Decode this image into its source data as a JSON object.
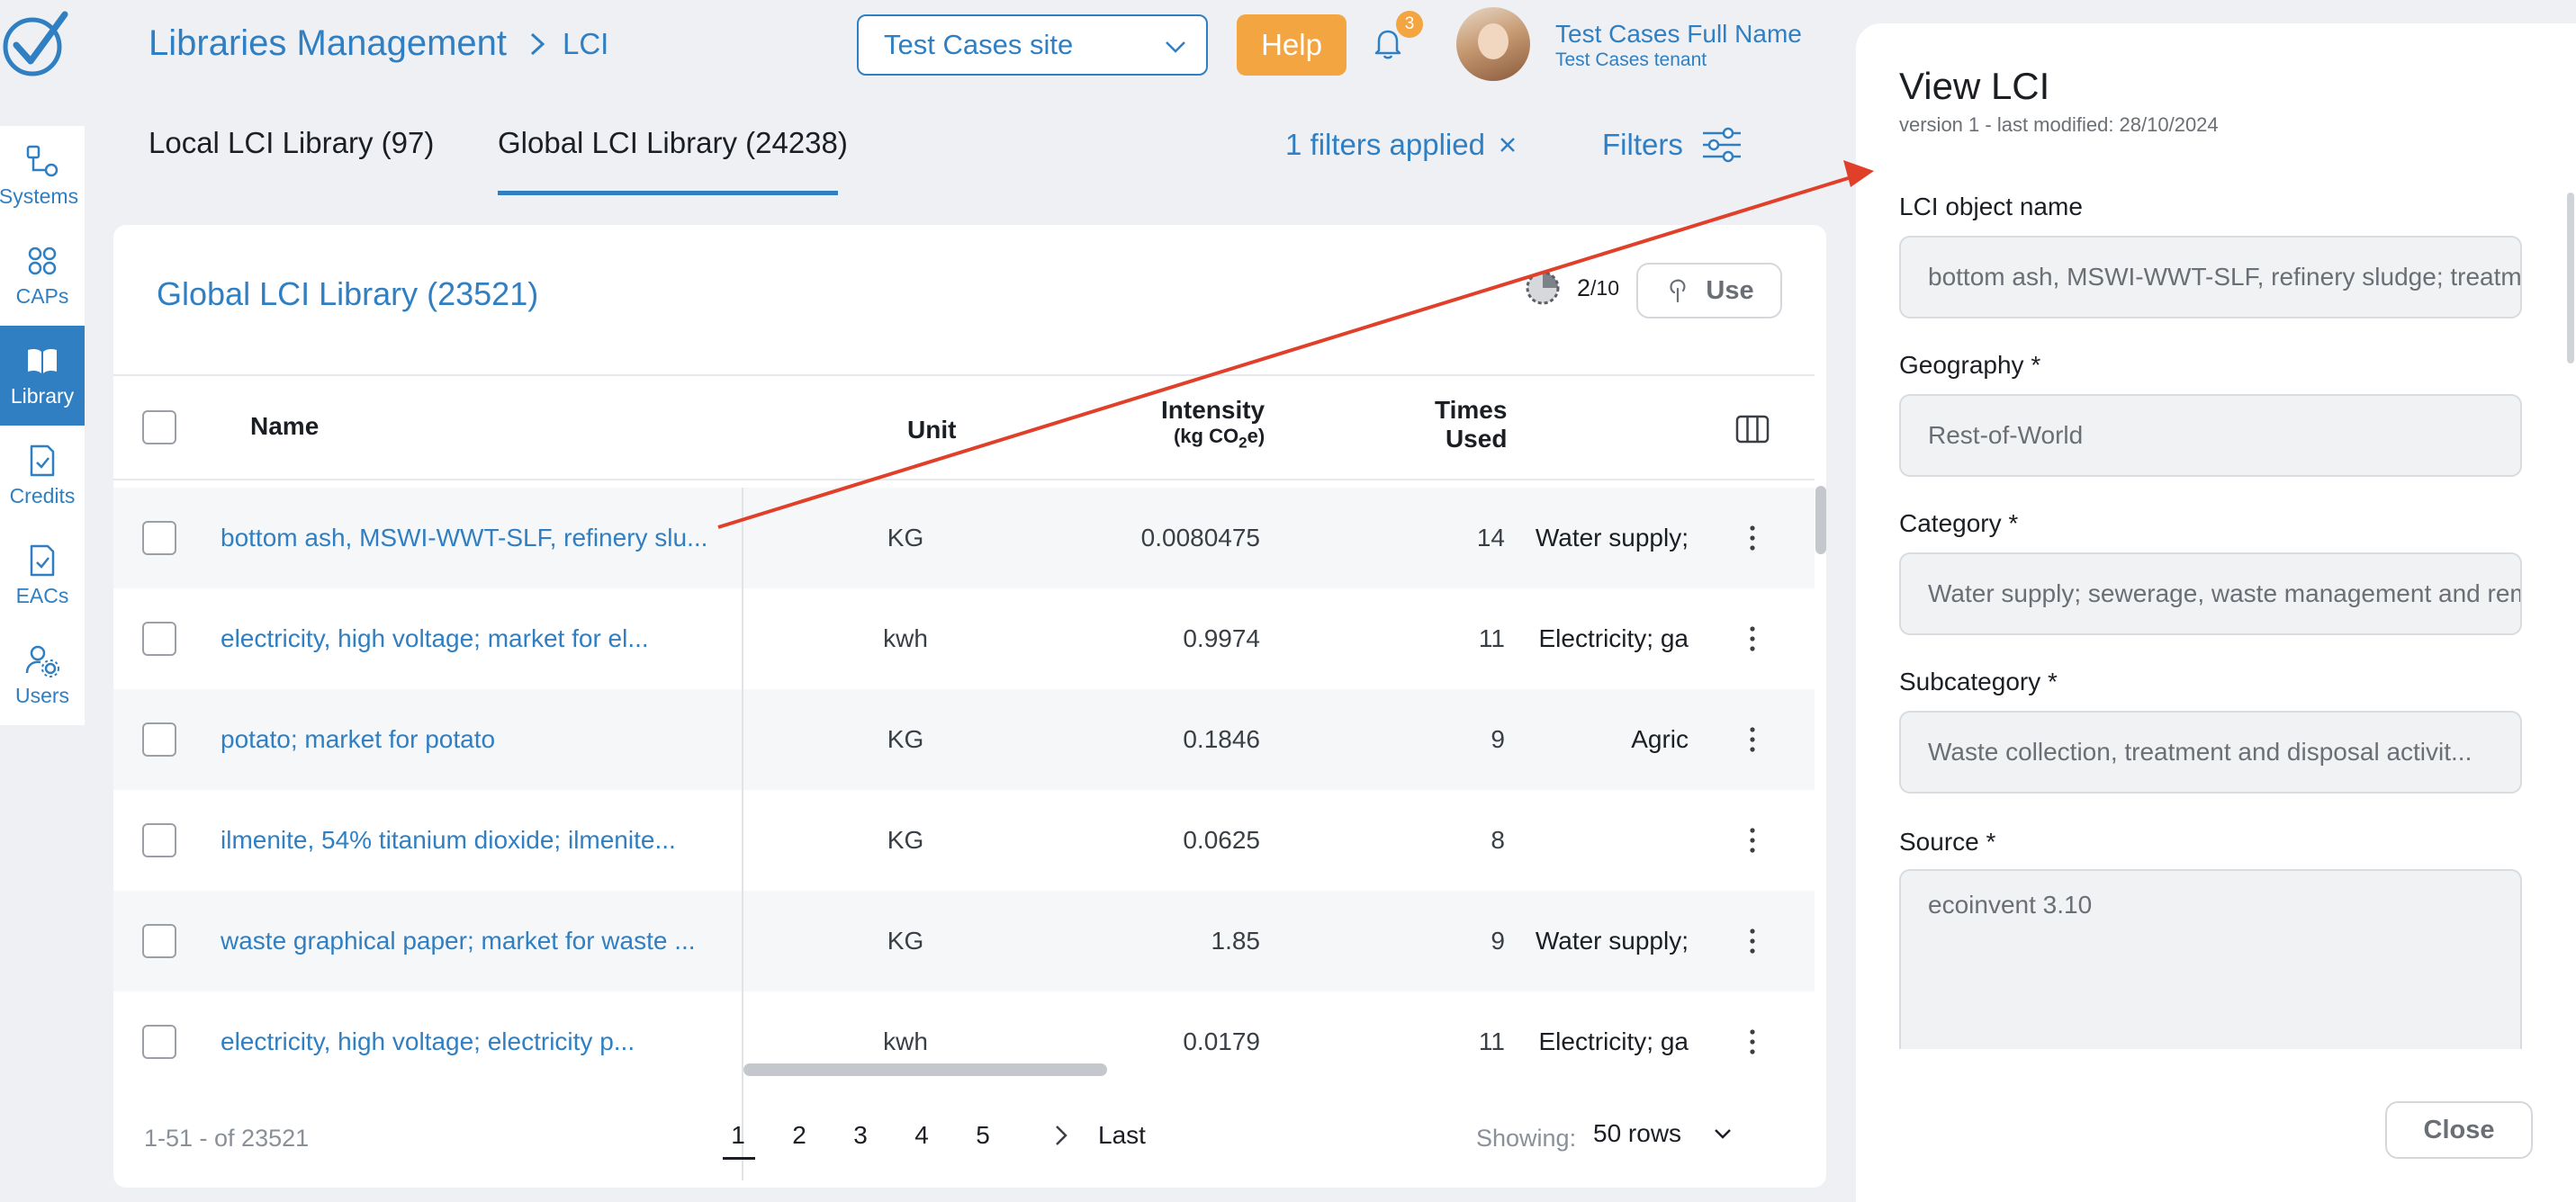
{
  "app": {
    "logo_icon": "check-logo-icon"
  },
  "sidebar": {
    "items": [
      {
        "label": "Systems",
        "icon": "systems-icon"
      },
      {
        "label": "CAPs",
        "icon": "grid-icon"
      },
      {
        "label": "Library",
        "icon": "book-icon",
        "active": true
      },
      {
        "label": "Credits",
        "icon": "credit-doc-icon"
      },
      {
        "label": "EACs",
        "icon": "eac-doc-icon"
      },
      {
        "label": "Users",
        "icon": "users-gear-icon"
      }
    ]
  },
  "header": {
    "breadcrumb_root": "Libraries Management",
    "breadcrumb_current": "LCI",
    "site_select": "Test Cases site",
    "help_label": "Help",
    "notification_count": "3",
    "user_name": "Test Cases Full Name",
    "user_tenant": "Test Cases tenant"
  },
  "tabs": {
    "local": "Local LCI Library (97)",
    "global": "Global LCI Library (24238)",
    "filters_applied": "1 filters applied",
    "filters_label": "Filters"
  },
  "table": {
    "title": "Global LCI Library (23521)",
    "usage_count": "2",
    "usage_total": "/10",
    "use_label": "Use",
    "columns": {
      "name": "Name",
      "unit": "Unit",
      "intensity": "Intensity",
      "intensity_unit_pre": "(kg CO",
      "intensity_unit_sub": "2",
      "intensity_unit_post": "e)",
      "times_line1": "Times",
      "times_line2": "Used"
    },
    "rows": [
      {
        "name": "bottom ash, MSWI-WWT-SLF, refinery slu...",
        "unit": "KG",
        "intensity": "0.0080475",
        "times": "14",
        "category": "Water supply;"
      },
      {
        "name": "electricity, high voltage; market for el...",
        "unit": "kwh",
        "intensity": "0.9974",
        "times": "11",
        "category": "Electricity; ga"
      },
      {
        "name": "potato; market for potato",
        "unit": "KG",
        "intensity": "0.1846",
        "times": "9",
        "category": "Agric"
      },
      {
        "name": "ilmenite, 54% titanium dioxide; ilmenite...",
        "unit": "KG",
        "intensity": "0.0625",
        "times": "8",
        "category": ""
      },
      {
        "name": "waste graphical paper; market for waste ...",
        "unit": "KG",
        "intensity": "1.85",
        "times": "9",
        "category": "Water supply;"
      },
      {
        "name": "electricity, high voltage; electricity p...",
        "unit": "kwh",
        "intensity": "0.0179",
        "times": "11",
        "category": "Electricity; ga"
      }
    ],
    "footer": {
      "range": "1-51 - of 23521",
      "pages": [
        "1",
        "2",
        "3",
        "4",
        "5"
      ],
      "current_page": "1",
      "last_label": "Last",
      "showing_label": "Showing:",
      "rows_per_page": "50 rows"
    }
  },
  "panel": {
    "title": "View LCI",
    "subtitle": "version 1 - last modified: 28/10/2024",
    "fields": {
      "name_label": "LCI object name",
      "name_value": "bottom ash, MSWI-WWT-SLF, refinery sludge; treatment of",
      "geography_label": "Geography *",
      "geography_value": "Rest-of-World",
      "category_label": "Category *",
      "category_value": "Water supply; sewerage, waste management and remediation",
      "subcategory_label": "Subcategory *",
      "subcategory_value": "Waste collection, treatment and disposal activit...",
      "source_label": "Source *",
      "source_value": "ecoinvent 3.10"
    },
    "close_label": "Close"
  },
  "colors": {
    "accent": "#2f7fc2",
    "help": "#f2a541",
    "annotation_arrow": "#e0402a"
  }
}
